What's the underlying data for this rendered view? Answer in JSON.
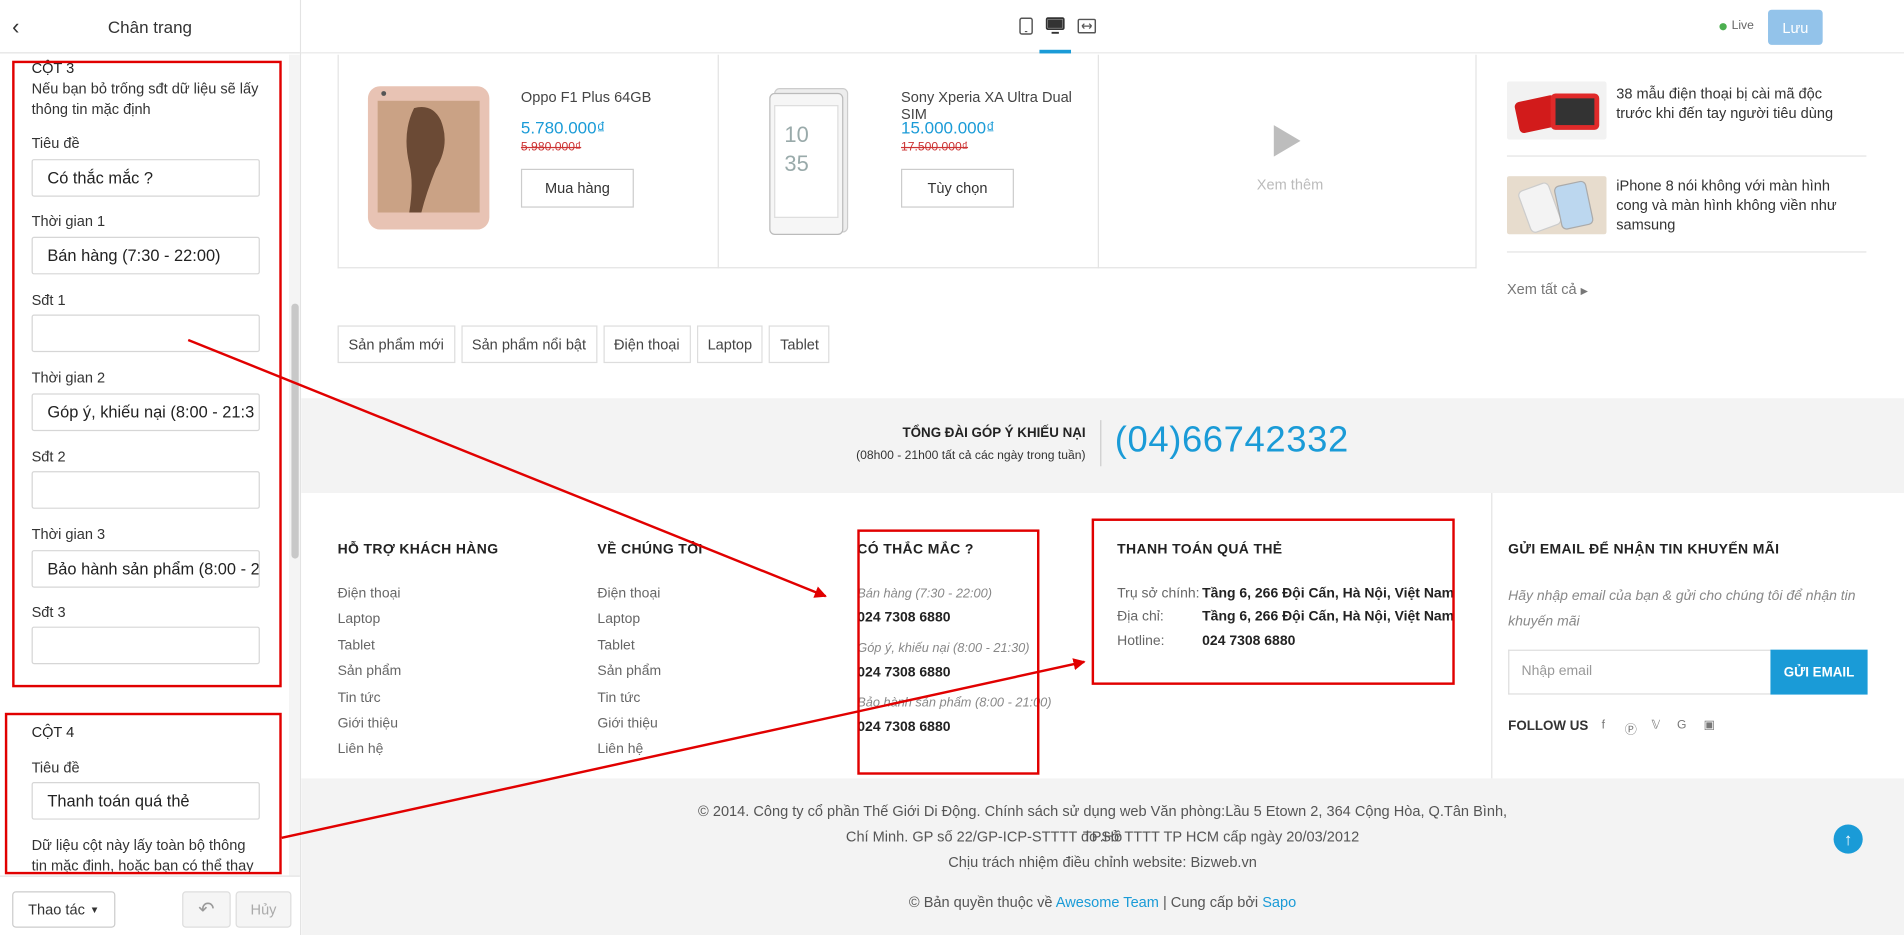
{
  "sidebar": {
    "title": "Chân trang",
    "col3": {
      "title": "CỘT 3",
      "note": "Nếu bạn bỏ trống sđt dữ liệu sẽ lấy thông tin mặc định",
      "fields": [
        {
          "label": "Tiêu đề",
          "value": "Có thắc mắc ?"
        },
        {
          "label": "Thời gian 1",
          "value": "Bán hàng (7:30 - 22:00)"
        },
        {
          "label": "Sđt 1",
          "value": ""
        },
        {
          "label": "Thời gian 2",
          "value": "Góp ý, khiếu nại (8:00 - 21:3"
        },
        {
          "label": "Sđt 2",
          "value": ""
        },
        {
          "label": "Thời gian 3",
          "value": "Bảo hành sản phẩm (8:00 - 2"
        },
        {
          "label": "Sđt 3",
          "value": ""
        }
      ]
    },
    "col4": {
      "title": "CỘT 4",
      "field_label": "Tiêu đề",
      "field_value": "Thanh toán quá thẻ",
      "note": "Dữ liệu cột này lấy toàn bộ thông tin mặc định, hoặc bạn có thể thay thế"
    },
    "footer": {
      "action_label": "Thao tác",
      "cancel_label": "Hủy"
    }
  },
  "topbar": {
    "live_label": "Live",
    "save_label": "Lưu"
  },
  "products": [
    {
      "name": "Oppo F1 Plus 64GB",
      "price": "5.780.000₫",
      "old_price": "5.980.000₫",
      "button": "Mua hàng"
    },
    {
      "name": "Sony Xperia XA Ultra Dual SIM",
      "price": "15.000.000₫",
      "old_price": "17.500.000₫",
      "button": "Tùy chọn"
    }
  ],
  "see_more": "Xem thêm",
  "news": [
    {
      "title": "38 mẫu điện thoại bị cài mã độc trước khi đến tay người tiêu dùng"
    },
    {
      "title": "iPhone 8 nói không với màn hình cong và màn hình không viền như samsung"
    }
  ],
  "view_all": "Xem tất cả",
  "tags": [
    "Sản phẩm mới",
    "Sản phẩm nổi bật",
    "Điện thoại",
    "Laptop",
    "Tablet"
  ],
  "hotline": {
    "title": "TỔNG ĐÀI GÓP Ý KHIẾU NẠI",
    "subtitle": "(08h00 - 21h00 tất cả các ngày trong tuần)",
    "number": "(04)66742332"
  },
  "footer": {
    "col1": {
      "title": "HỖ TRỢ KHÁCH HÀNG",
      "links": [
        "Điện thoại",
        "Laptop",
        "Tablet",
        "Sản phẩm",
        "Tin tức",
        "Giới thiệu",
        "Liên hệ"
      ]
    },
    "col2": {
      "title": "VỀ CHÚNG TÔI",
      "links": [
        "Điện thoại",
        "Laptop",
        "Tablet",
        "Sản phẩm",
        "Tin tức",
        "Giới thiệu",
        "Liên hệ"
      ]
    },
    "col3": {
      "title": "CÓ THẮC MẮC ?",
      "items": [
        {
          "time": "Bán hàng (7:30 - 22:00)",
          "phone": "024 7308 6880"
        },
        {
          "time": "Góp ý, khiếu nại (8:00 - 21:30)",
          "phone": "024 7308 6880"
        },
        {
          "time": "Bảo hành sản phẩm (8:00 - 21:00)",
          "phone": "024 7308 6880"
        }
      ]
    },
    "col4": {
      "title": "THANH TOÁN QUÁ THẺ",
      "rows": [
        {
          "key": "Trụ sở chính:",
          "value": "Tầng 6, 266 Đội Cấn, Hà Nội, Việt Nam"
        },
        {
          "key": "Địa chỉ:",
          "value": "Tầng 6, 266 Đội Cấn, Hà Nội, Việt Nam"
        },
        {
          "key": "Hotline:",
          "value": "024 7308 6880"
        }
      ]
    },
    "newsletter": {
      "title": "GỬI EMAIL ĐỂ NHẬN TIN KHUYẾN MÃI",
      "text": "Hãy nhập email của bạn & gửi cho chúng tôi để nhận tin khuyến mãi",
      "placeholder": "Nhập email",
      "button": "GỬI EMAIL",
      "follow": "FOLLOW US"
    },
    "copyright_lines": [
      "© 2014. Công ty cổ phần Thế Giới Di Động. Chính sách sử dụng web Văn phòng:Lầu 5 Etown 2, 364 Cộng Hòa, Q.Tân Bình, TP.Hồ",
      "Chí Minh. GP số 22/GP-ICP-STTTT do Sở TTTT TP HCM cấp ngày 20/03/2012",
      "Chịu trách nhiệm điều chỉnh website: Bizweb.vn"
    ],
    "credit_prefix": "© Bản quyền thuộc về",
    "credit_team": "Awesome Team",
    "credit_mid": "| Cung cấp bởi",
    "credit_sapo": "Sapo"
  },
  "colors": {
    "accent": "#1a9bd7",
    "annotation": "#e10000",
    "save_disabled": "#93c3ea"
  }
}
